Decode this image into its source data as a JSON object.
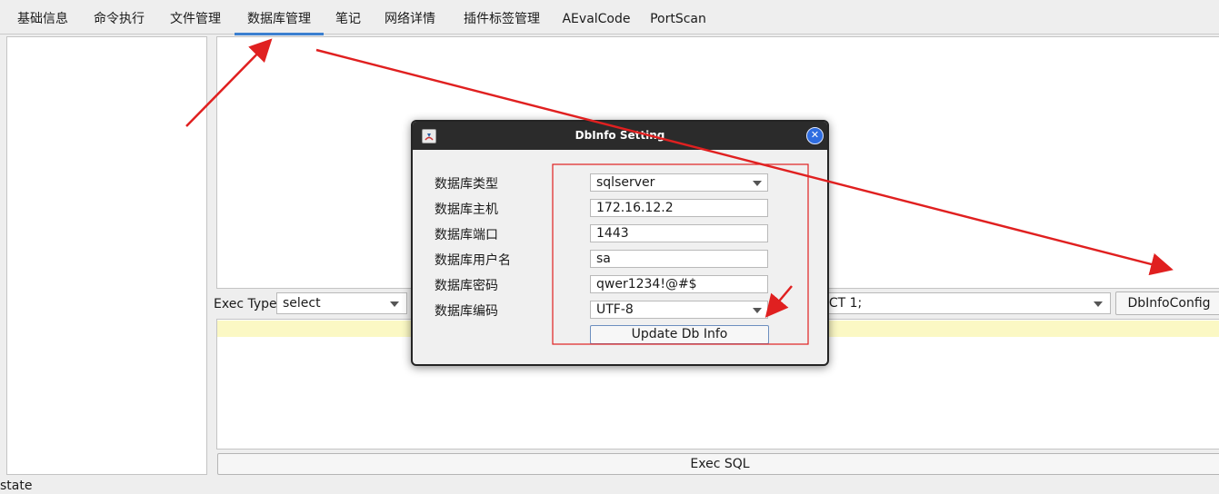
{
  "tabs": [
    {
      "label": "基础信息",
      "active": false
    },
    {
      "label": "命令执行",
      "active": false
    },
    {
      "label": "文件管理",
      "active": false
    },
    {
      "label": "数据库管理",
      "active": true
    },
    {
      "label": "笔记",
      "active": false
    },
    {
      "label": "网络详情",
      "active": false
    },
    {
      "label": "插件标签管理",
      "active": false
    },
    {
      "label": "AEvalCode",
      "active": false
    },
    {
      "label": "PortScan",
      "active": false
    }
  ],
  "exec": {
    "type_label": "Exec Type",
    "type_value": "select",
    "sql_value": "ECT 1;",
    "dbinfo_button": "DbInfoConfig",
    "exec_button": "Exec SQL"
  },
  "status": "state",
  "dialog": {
    "title": "DbInfo Setting",
    "fields": [
      {
        "label": "数据库类型",
        "value": "sqlserver",
        "dropdown": true
      },
      {
        "label": "数据库主机",
        "value": "172.16.12.2",
        "dropdown": false
      },
      {
        "label": "数据库端口",
        "value": "1443",
        "dropdown": false
      },
      {
        "label": "数据库用户名",
        "value": "sa",
        "dropdown": false
      },
      {
        "label": "数据库密码",
        "value": "qwer1234!@#$",
        "dropdown": false
      },
      {
        "label": "数据库编码",
        "value": "UTF-8",
        "dropdown": true
      }
    ],
    "update_button": "Update Db Info"
  },
  "colors": {
    "accent": "#3b7fd0",
    "annotation": "#e02020",
    "highlight_row": "#fbf8c4"
  }
}
